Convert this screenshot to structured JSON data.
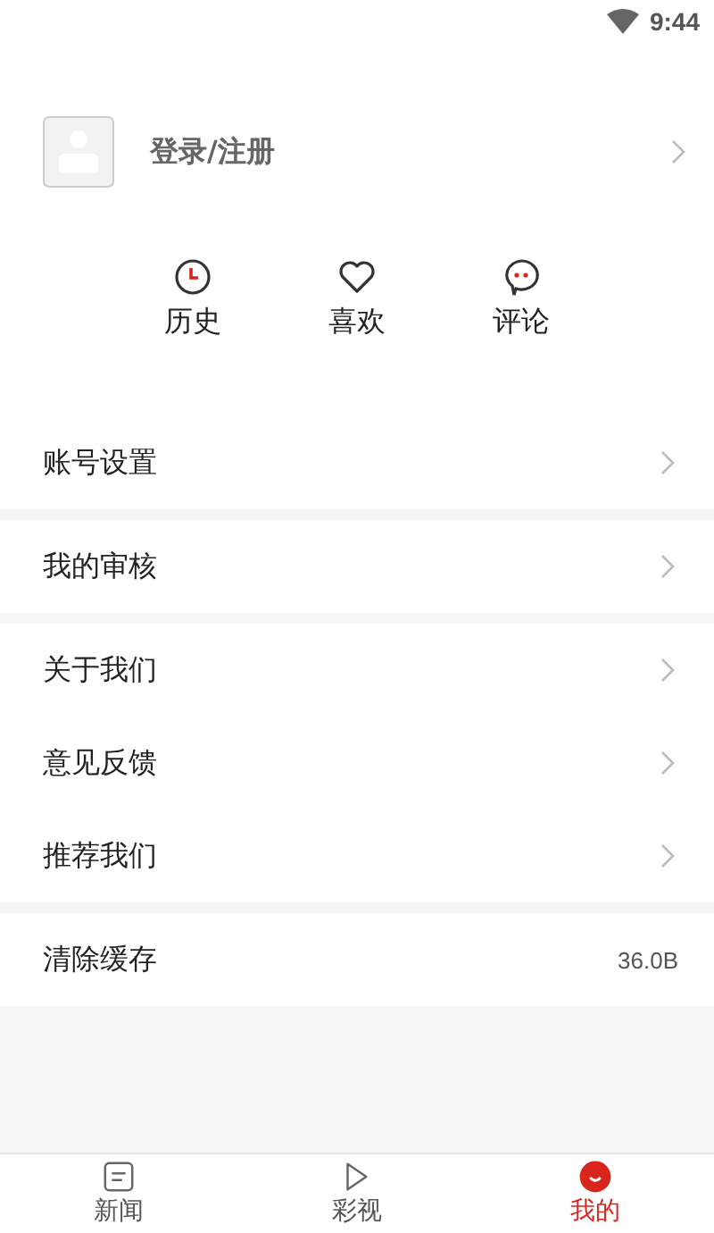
{
  "status_bar": {
    "time": "9:44"
  },
  "profile": {
    "label": "登录/注册"
  },
  "shortcuts": [
    {
      "kind": "history",
      "label": "历史"
    },
    {
      "kind": "like",
      "label": "喜欢"
    },
    {
      "kind": "comment",
      "label": "评论"
    }
  ],
  "menu_groups": [
    {
      "items": [
        {
          "kind": "link",
          "label": "账号设置"
        }
      ]
    },
    {
      "items": [
        {
          "kind": "link",
          "label": "我的审核"
        }
      ]
    },
    {
      "items": [
        {
          "kind": "link",
          "label": "关于我们"
        },
        {
          "kind": "link",
          "label": "意见反馈"
        },
        {
          "kind": "link",
          "label": "推荐我们"
        }
      ]
    },
    {
      "items": [
        {
          "kind": "value",
          "label": "清除缓存",
          "value": "36.0B"
        }
      ]
    }
  ],
  "tabs": [
    {
      "kind": "news",
      "label": "新闻",
      "selected": false
    },
    {
      "kind": "video",
      "label": "彩视",
      "selected": false
    },
    {
      "kind": "me",
      "label": "我的",
      "selected": true
    }
  ]
}
